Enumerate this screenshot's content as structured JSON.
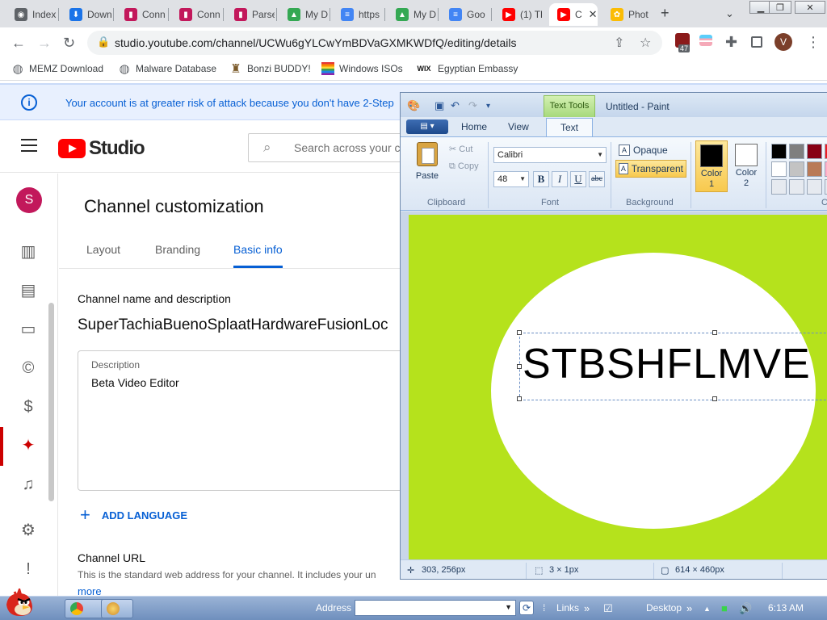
{
  "browser": {
    "tabs": [
      {
        "title": "Index",
        "color": "#5f6368",
        "glyph": "◉"
      },
      {
        "title": "Down",
        "color": "#1a73e8",
        "glyph": "⬇"
      },
      {
        "title": "Conn",
        "color": "#c2185b",
        "glyph": "▮"
      },
      {
        "title": "Conn",
        "color": "#c2185b",
        "glyph": "▮"
      },
      {
        "title": "Parse",
        "color": "#c2185b",
        "glyph": "▮"
      },
      {
        "title": "My D",
        "color": "#34a853",
        "glyph": "▲"
      },
      {
        "title": "https",
        "color": "#4285f4",
        "glyph": "≡"
      },
      {
        "title": "My D",
        "color": "#34a853",
        "glyph": "▲"
      },
      {
        "title": "Goo",
        "color": "#4285f4",
        "glyph": "≡"
      },
      {
        "title": "(1) Tl",
        "color": "#ff0000",
        "glyph": "▶"
      },
      {
        "title": "C",
        "color": "#ff0000",
        "glyph": "▶",
        "active": true
      },
      {
        "title": "Phot",
        "color": "#fbbc04",
        "glyph": "✿"
      }
    ],
    "new_tab_glyph": "+",
    "url": "studio.youtube.com/channel/UCWu6gYLCwYmBDVaGXMKWDfQ/editing/details",
    "extension_badge": "47",
    "profile_initial": "V",
    "bookmarks": [
      {
        "label": "MEMZ Download",
        "icon": "globe-icon",
        "color": "#5f6368"
      },
      {
        "label": "Malware Database",
        "icon": "globe-icon",
        "color": "#5f6368"
      },
      {
        "label": "Bonzi BUDDY!",
        "icon": "bonzi-icon",
        "color": "#7b5a2a"
      },
      {
        "label": "Windows ISOs",
        "icon": "rainbow-flag-icon",
        "color": "#e53935"
      },
      {
        "label": "Egyptian Embassy",
        "icon": "wix-icon",
        "color": "#111111"
      }
    ]
  },
  "studio": {
    "banner_text": "Your account is at greater risk of attack because you don't have 2-Step",
    "logo_text": "Studio",
    "search_placeholder": "Search across your c",
    "avatar_initial": "S",
    "page_title": "Channel customization",
    "tabs": [
      "Layout",
      "Branding",
      "Basic info"
    ],
    "active_tab": "Basic info",
    "section_name_title": "Channel name and description",
    "channel_name": "SuperTachiaBuenoSplaatHardwareFusionLoc",
    "description_label": "Description",
    "description_value": "Beta Video Editor",
    "add_language": "ADD LANGUAGE",
    "channel_url_title": "Channel URL",
    "channel_url_desc": "This is the standard web address for your channel. It includes your un",
    "more_link": "more",
    "brand_red": "#ff0000",
    "accent_blue": "#065fd4"
  },
  "paint": {
    "context_tab": "Text Tools",
    "title": "Untitled - Paint",
    "ribbon_tabs": [
      "Home",
      "View",
      "Text"
    ],
    "active_ribbon_tab": "Text",
    "clipboard": {
      "paste": "Paste",
      "cut": "Cut",
      "copy": "Copy",
      "group": "Clipboard"
    },
    "font": {
      "name": "Calibri",
      "size": "48",
      "bold": "B",
      "italic": "I",
      "underline": "U",
      "strike": "abc",
      "group": "Font"
    },
    "background": {
      "opaque": "Opaque",
      "transparent": "Transparent",
      "group": "Background"
    },
    "color1": {
      "label_line1": "Color",
      "label_line2": "1",
      "value": "#000000"
    },
    "color2": {
      "label_line1": "Color",
      "label_line2": "2",
      "value": "#ffffff"
    },
    "colors_group_label": "C",
    "palette": [
      "#000000",
      "#7f7f7f",
      "#880015",
      "#ed1c24",
      "#ffffff",
      "#c3c3c3",
      "#b97a57",
      "#ffaec9",
      "#e6eaf0",
      "#e6eaf0",
      "#e6eaf0",
      "#e6eaf0"
    ],
    "canvas_background": "#b5e21c",
    "canvas_text": "STBSHFLMVE",
    "status": {
      "cursor": "303, 256px",
      "selection": "3 × 1px",
      "image_size": "614 × 460px"
    }
  },
  "taskbar": {
    "address_label": "Address",
    "links_label": "Links",
    "desktop_label": "Desktop",
    "clock": "6:13 AM"
  }
}
